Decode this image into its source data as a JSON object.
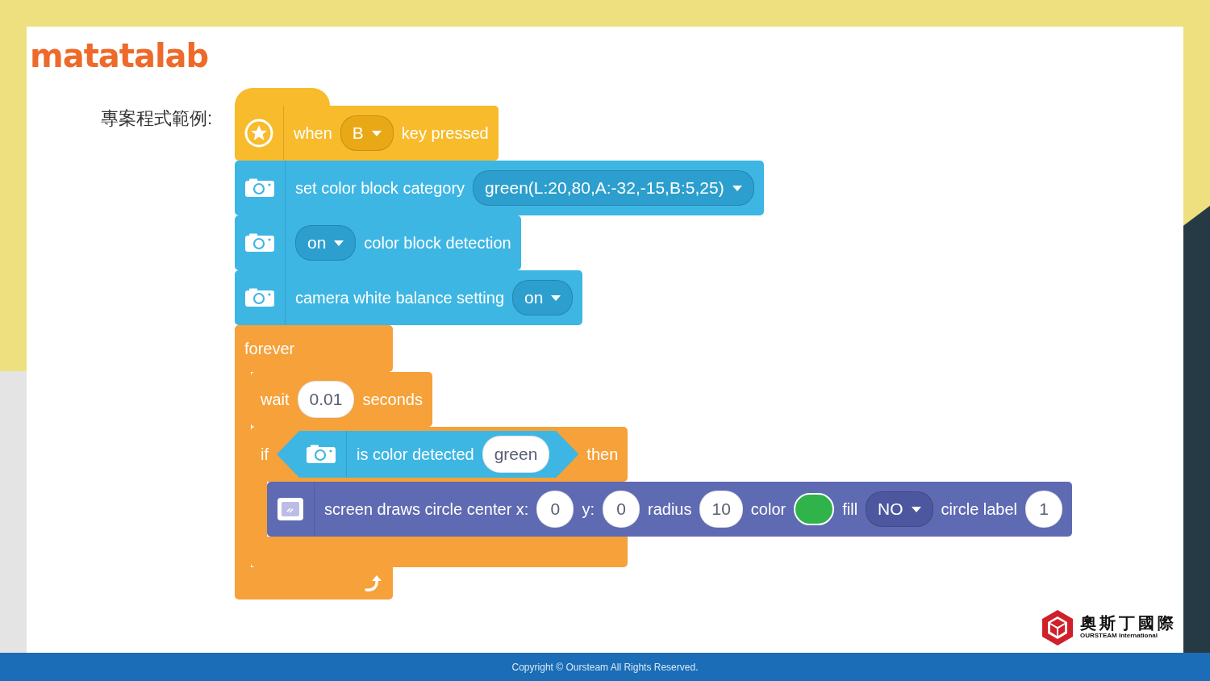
{
  "logo": {
    "text": "matatalab"
  },
  "heading": "專案程式範例:",
  "script": [
    {
      "kind": "hat",
      "parts": [
        {
          "kind": "label",
          "text": "when"
        },
        {
          "kind": "dropdown",
          "text": "B"
        },
        {
          "kind": "label",
          "text": "key pressed"
        }
      ]
    },
    {
      "kind": "camera",
      "parts": [
        {
          "kind": "label",
          "text": "set color block category"
        },
        {
          "kind": "dropdown",
          "text": "green(L:20,80,A:-32,-15,B:5,25)"
        }
      ]
    },
    {
      "kind": "camera",
      "parts": [
        {
          "kind": "dropdown",
          "text": "on"
        },
        {
          "kind": "label",
          "text": "color block detection"
        }
      ]
    },
    {
      "kind": "camera",
      "parts": [
        {
          "kind": "label",
          "text": "camera white balance setting"
        },
        {
          "kind": "dropdown",
          "text": "on"
        }
      ]
    },
    {
      "kind": "loop",
      "parts": [
        {
          "kind": "label",
          "text": "forever"
        }
      ],
      "children": [
        {
          "kind": "control",
          "parts": [
            {
              "kind": "label",
              "text": "wait"
            },
            {
              "kind": "input",
              "text": "0.01"
            },
            {
              "kind": "label",
              "text": "seconds"
            }
          ]
        },
        {
          "kind": "branch",
          "parts": [
            {
              "kind": "label",
              "text": "if"
            },
            {
              "kind": "condition",
              "parts": [
                {
                  "kind": "label",
                  "text": "is color detected"
                },
                {
                  "kind": "input",
                  "text": "green"
                }
              ]
            },
            {
              "kind": "label",
              "text": "then"
            }
          ],
          "children": [
            {
              "kind": "display",
              "parts": [
                {
                  "kind": "label",
                  "text": "screen draws circle center x:"
                },
                {
                  "kind": "input",
                  "text": "0"
                },
                {
                  "kind": "label",
                  "text": "y:"
                },
                {
                  "kind": "input",
                  "text": "0"
                },
                {
                  "kind": "label",
                  "text": "radius"
                },
                {
                  "kind": "input",
                  "text": "10"
                },
                {
                  "kind": "label",
                  "text": "color"
                },
                {
                  "kind": "swatch",
                  "color": "#2fb34a"
                },
                {
                  "kind": "label",
                  "text": "fill"
                },
                {
                  "kind": "dropdown",
                  "text": "NO"
                },
                {
                  "kind": "label",
                  "text": "circle label"
                },
                {
                  "kind": "input",
                  "text": "1"
                }
              ]
            }
          ]
        }
      ]
    }
  ],
  "brand": {
    "name": "奧斯丁國際",
    "subtitle": "OURSTEAM International"
  },
  "footer": "Copyright © Oursteam All Rights Reserved."
}
